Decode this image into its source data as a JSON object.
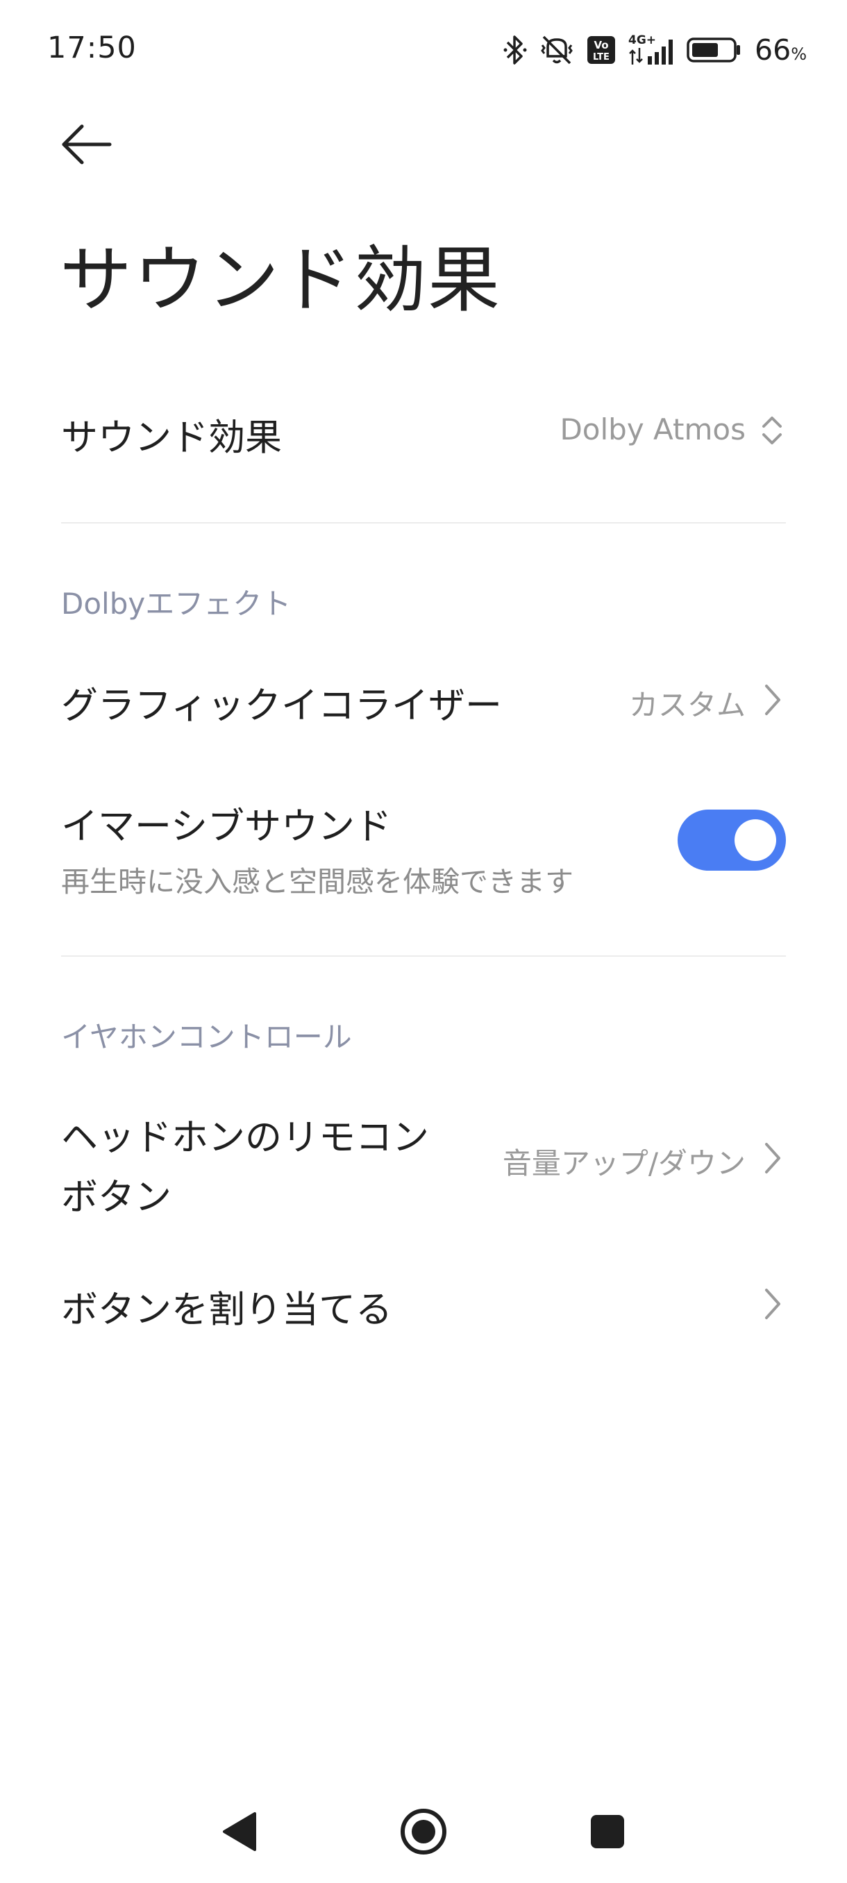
{
  "status_bar": {
    "time": "17:50",
    "battery_percent": "66",
    "battery_unit": "%",
    "battery_level": 0.66,
    "network_label": "4G+",
    "volte_label": "Vo LTE",
    "icons": [
      "bluetooth-icon",
      "vibrate-icon",
      "volte-icon",
      "signal-icon",
      "battery-icon"
    ]
  },
  "header": {
    "back_icon": "back-arrow-icon",
    "title": "サウンド効果"
  },
  "settings": {
    "sound_effect": {
      "label": "サウンド効果",
      "value": "Dolby Atmos",
      "icon": "updown-chevron-icon"
    },
    "dolby_section": {
      "header": "Dolbyエフェクト",
      "equalizer": {
        "label": "グラフィックイコライザー",
        "value": "カスタム"
      },
      "immersive": {
        "label": "イマーシブサウンド",
        "subtitle": "再生時に没入感と空間感を体験できます",
        "enabled": true
      }
    },
    "earphone_section": {
      "header": "イヤホンコントロール",
      "remote_button": {
        "label_line1": "ヘッドホンのリモコン",
        "label_line2": "ボタン",
        "value": "音量アップ/ダウン"
      },
      "assign_buttons": {
        "label": "ボタンを割り当てる"
      }
    }
  },
  "colors": {
    "accent": "#4a7df3",
    "section_header": "#8a90a6",
    "secondary_text": "#9a9a9a",
    "divider": "#ececec"
  },
  "nav_bar": {
    "icons": [
      "nav-back-icon",
      "nav-home-icon",
      "nav-recents-icon"
    ]
  }
}
